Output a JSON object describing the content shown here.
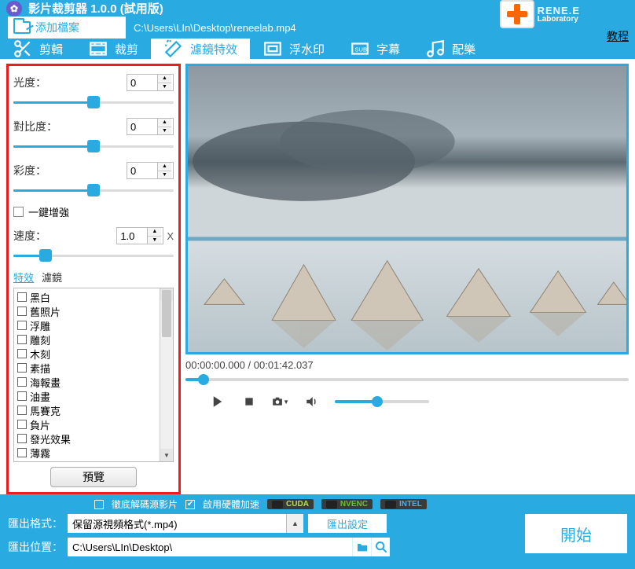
{
  "titlebar": {
    "title": "影片裁剪器 1.0.0 (試用版)"
  },
  "brand": {
    "line1": "RENE.E",
    "line2": "Laboratory"
  },
  "tutorial": "教程",
  "addfile": {
    "label": "添加檔案",
    "path": "C:\\Users\\LIn\\Desktop\\reneelab.mp4"
  },
  "tabs": {
    "edit": "剪輯",
    "crop": "裁剪",
    "filter": "濾鏡特效",
    "watermark": "浮水印",
    "subtitle": "字幕",
    "music": "配樂"
  },
  "panel": {
    "brightness_label": "光度：",
    "brightness_value": "0",
    "contrast_label": "對比度：",
    "contrast_value": "0",
    "saturation_label": "彩度：",
    "saturation_value": "0",
    "one_click_label": "一鍵增強",
    "speed_label": "速度：",
    "speed_value": "1.0",
    "x_suffix": "X",
    "subtab_effects": "特效",
    "subtab_filters": "濾鏡",
    "effects": [
      "黑白",
      "舊照片",
      "浮雕",
      "雕刻",
      "木刻",
      "素描",
      "海報畫",
      "油畫",
      "馬賽克",
      "負片",
      "發光效果",
      "薄霧"
    ],
    "preview_btn": "預覽"
  },
  "player": {
    "time": "00:00:00.000 / 00:01:42.037"
  },
  "bottom": {
    "thorough_label": "徹底解碼源影片",
    "hwacc_label": "啟用硬體加速",
    "gpu_cuda": "CUDA",
    "gpu_nvenc": "NVENC",
    "gpu_intel": "INTEL",
    "format_label": "匯出格式：",
    "format_value": "保留源視頻格式(*.mp4)",
    "settings_btn": "匯出設定",
    "path_label": "匯出位置：",
    "path_value": "C:\\Users\\LIn\\Desktop\\",
    "start_btn": "開始"
  }
}
